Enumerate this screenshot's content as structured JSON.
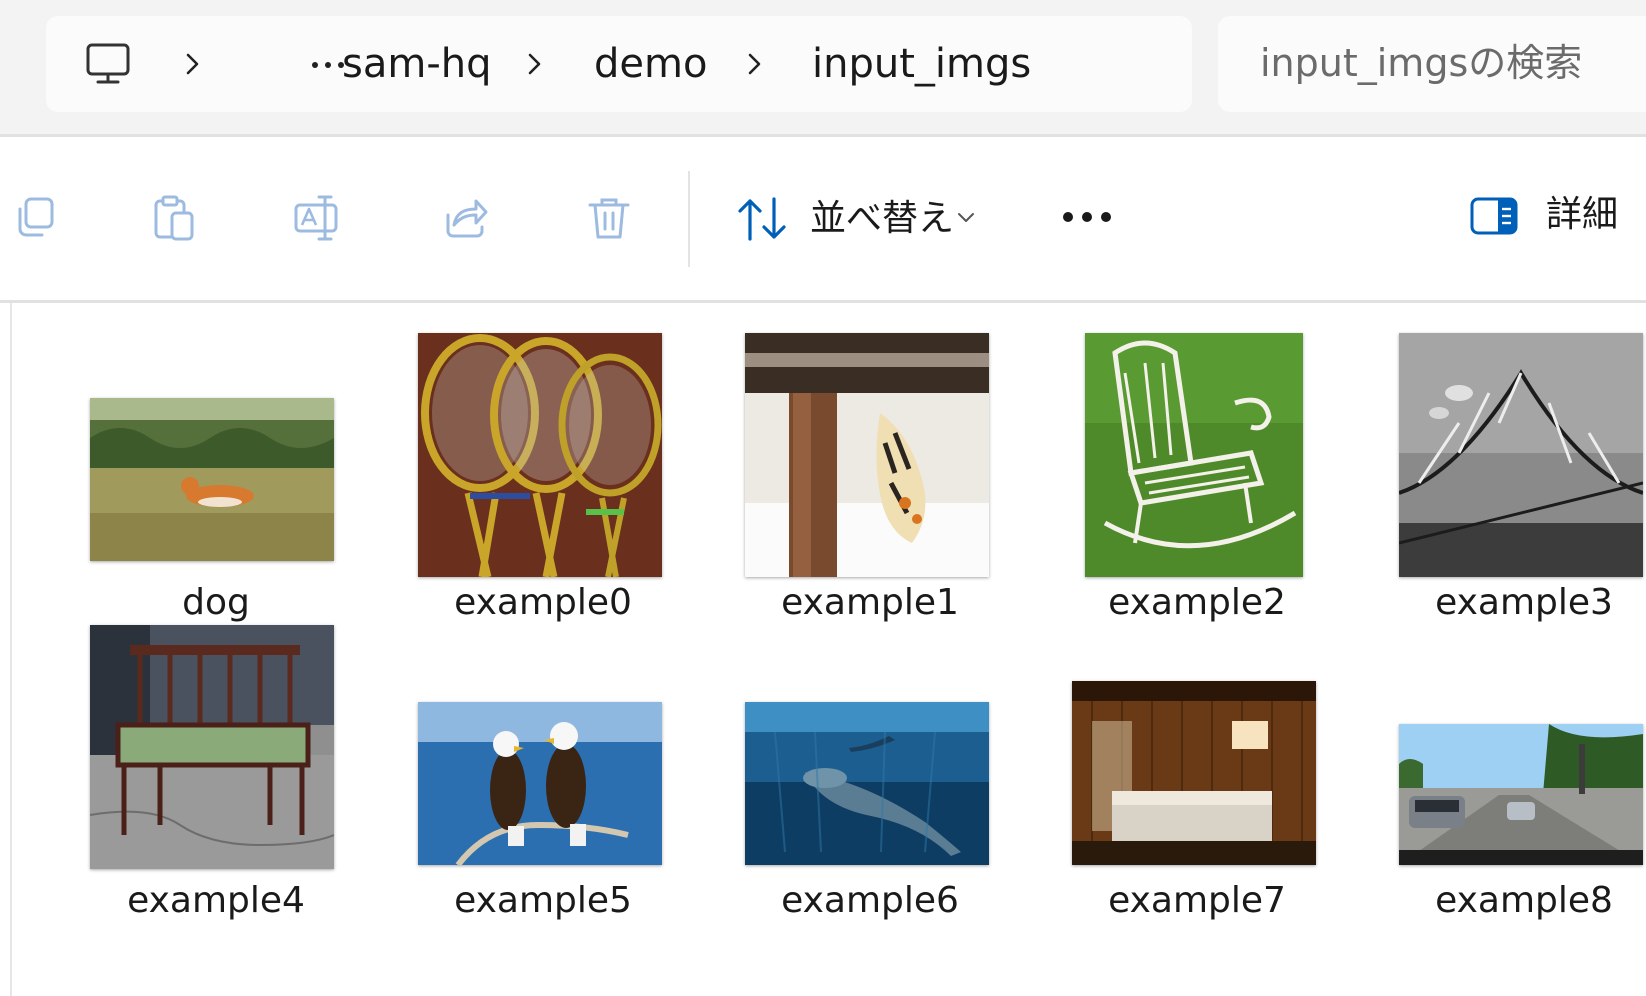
{
  "address_bar": {
    "breadcrumb": [
      "sam-hq",
      "demo",
      "input_imgs"
    ],
    "overflow_label": "…"
  },
  "search": {
    "placeholder": "input_imgsの検索",
    "value": ""
  },
  "toolbar": {
    "copy_icon": "copy-icon",
    "paste_icon": "paste-icon",
    "rename_icon": "rename-icon",
    "share_icon": "share-icon",
    "delete_icon": "trash-icon",
    "sort_label": "並べ替え",
    "more_icon": "more-icon",
    "details_label": "詳細",
    "accent_color": "#005fb8",
    "disabled_color": "#9dbbe0"
  },
  "files": [
    {
      "name": "dog"
    },
    {
      "name": "example0"
    },
    {
      "name": "example1"
    },
    {
      "name": "example2"
    },
    {
      "name": "example3"
    },
    {
      "name": "example4"
    },
    {
      "name": "example5"
    },
    {
      "name": "example6"
    },
    {
      "name": "example7"
    },
    {
      "name": "example8"
    }
  ]
}
